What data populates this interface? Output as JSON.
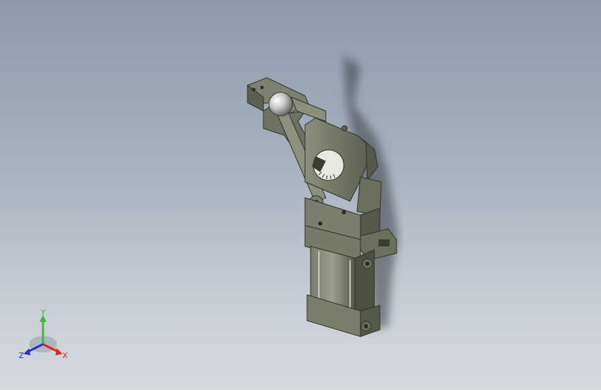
{
  "viewport": {
    "background_top": "#8e9aab",
    "background_bottom": "#d6dadf"
  },
  "model": {
    "type": "pneumatic toggle clamp",
    "body_color": "#6b6f5e",
    "highlight_color": "#8a8e7c",
    "dark_color": "#3b3d33",
    "knob_color": "#e0e0e0"
  },
  "triad": {
    "x_label": "X",
    "y_label": "Y",
    "z_label": "Z",
    "x_color": "#e0201a",
    "y_color": "#2fbf2f",
    "z_color": "#2030d0"
  }
}
